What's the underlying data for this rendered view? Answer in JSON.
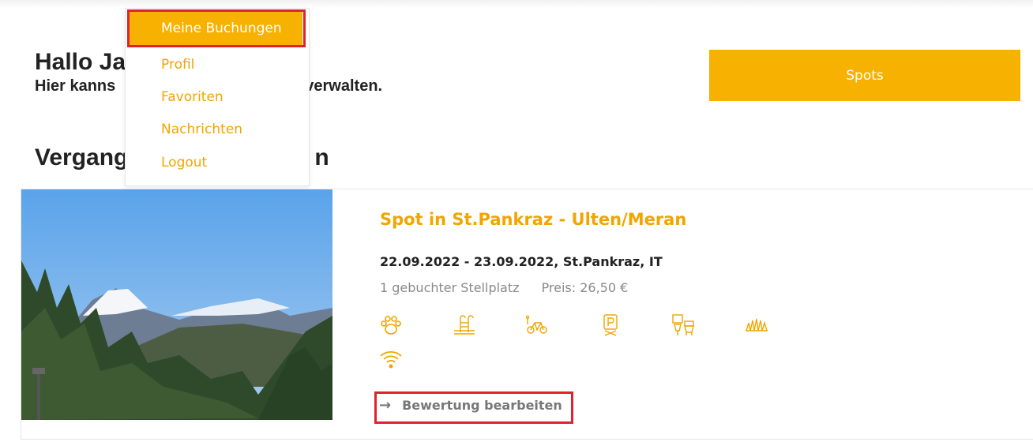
{
  "header": {
    "greeting": "Hallo Ja",
    "subtitle": "Hier kanns",
    "subtitle_end": "verwalten."
  },
  "menu": {
    "items": [
      {
        "label": "Meine Buchungen",
        "active": true
      },
      {
        "label": "Profil"
      },
      {
        "label": "Favoriten"
      },
      {
        "label": "Nachrichten"
      },
      {
        "label": "Logout"
      }
    ]
  },
  "spots_button": "Spots",
  "section": {
    "title_start": "Vergang",
    "title_end": "n"
  },
  "booking": {
    "title": "Spot in St.Pankraz - Ulten/Meran",
    "dates": "22.09.2022 - 23.09.2022, St.Pankraz, IT",
    "spots": "1 gebuchter Stellplatz",
    "price": "Preis: 26,50 €",
    "amenities": [
      "paw-icon",
      "pool-ladder-icon",
      "bike-icon",
      "parking-icon",
      "toilet-icon",
      "grass-icon",
      "wifi-icon"
    ],
    "review_link": "Bewertung bearbeiten"
  },
  "colors": {
    "accent": "#f7b100",
    "accent_text": "#f0a500",
    "highlight": "#e0212f"
  }
}
